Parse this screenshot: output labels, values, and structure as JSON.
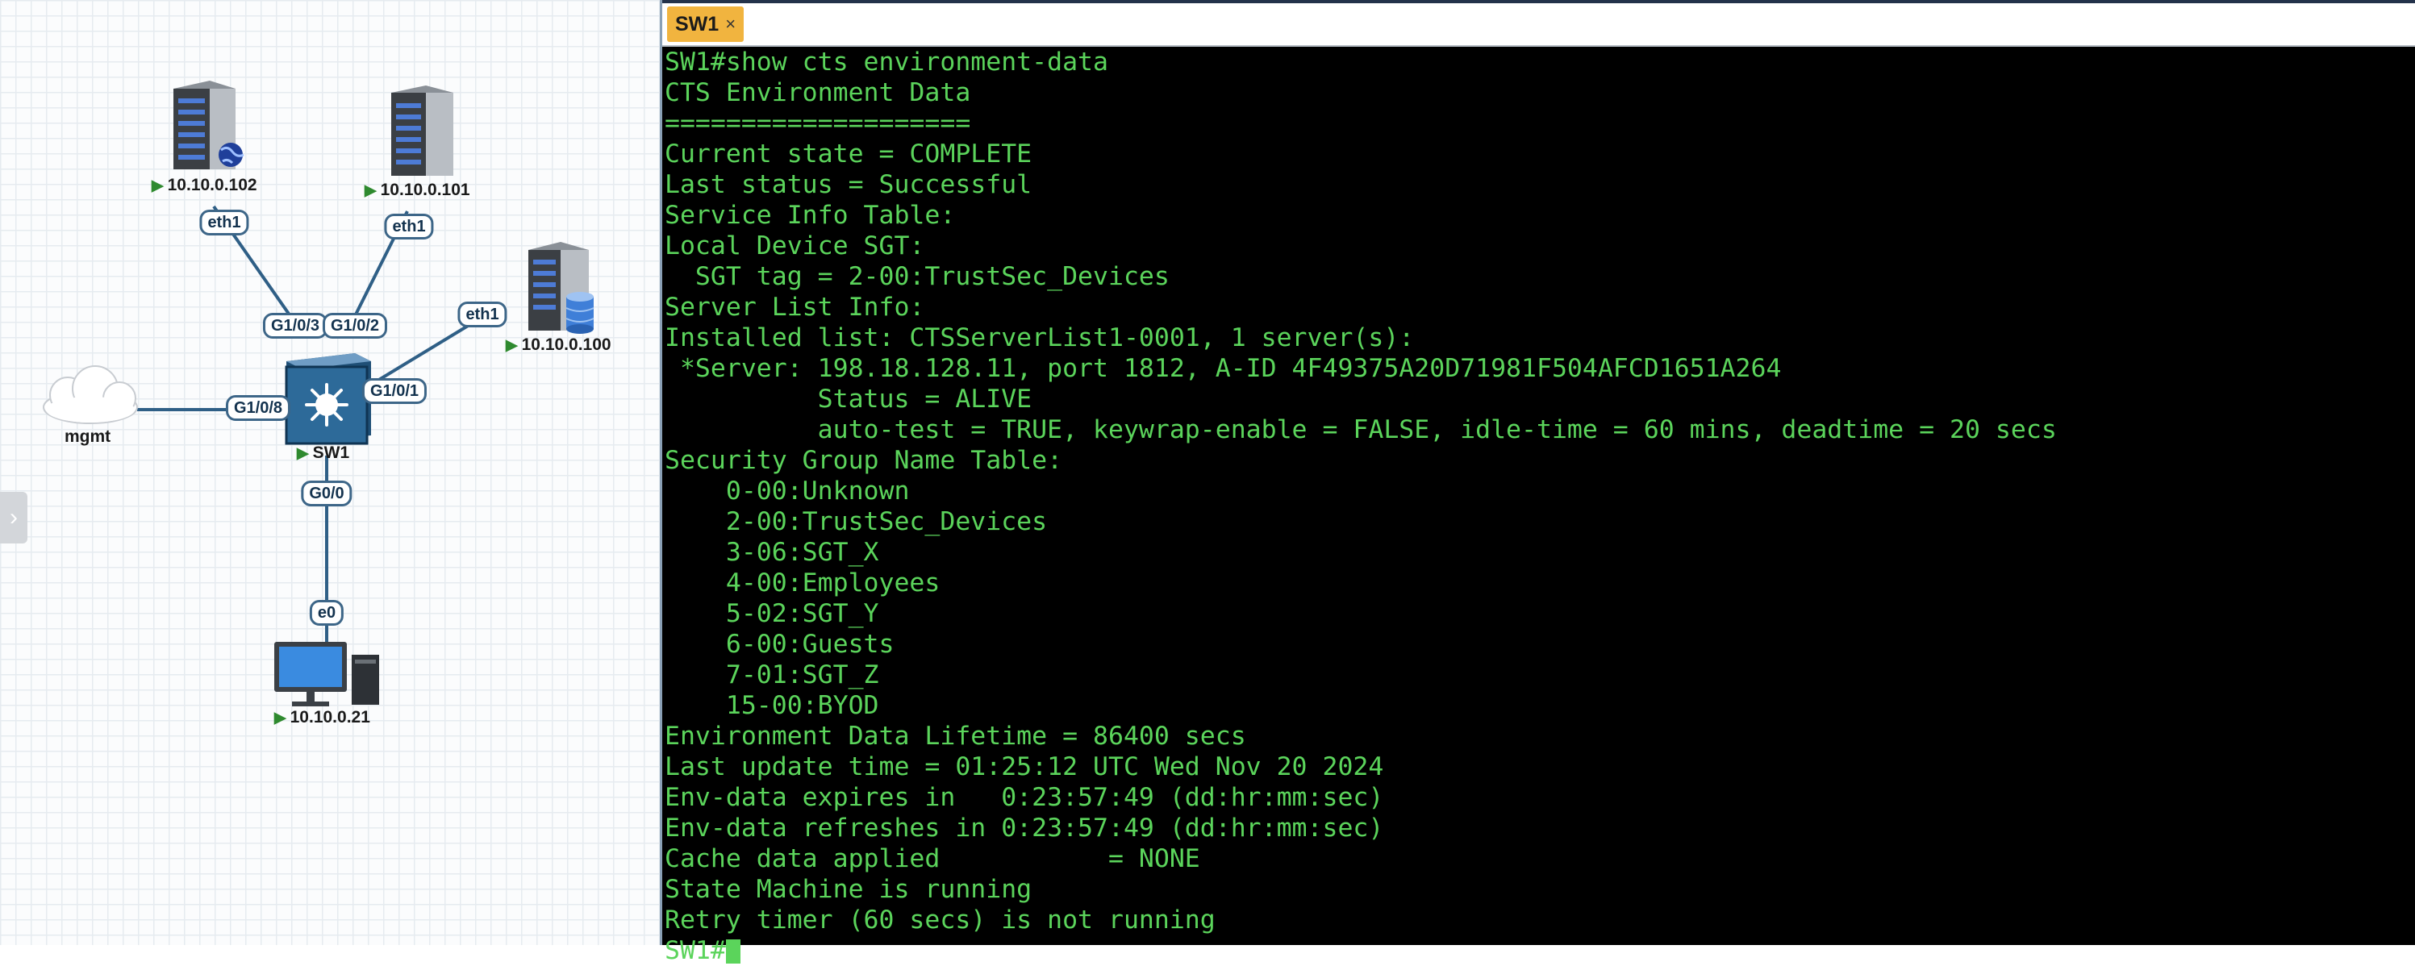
{
  "terminal": {
    "tab": {
      "title": "SW1",
      "close": "×"
    },
    "lines": [
      "SW1#show cts environment-data",
      "CTS Environment Data",
      "====================",
      "Current state = COMPLETE",
      "Last status = Successful",
      "Service Info Table:",
      "Local Device SGT:",
      "  SGT tag = 2-00:TrustSec_Devices",
      "Server List Info:",
      "Installed list: CTSServerList1-0001, 1 server(s):",
      " *Server: 198.18.128.11, port 1812, A-ID 4F49375A20D71981F504AFCD1651A264",
      "          Status = ALIVE",
      "          auto-test = TRUE, keywrap-enable = FALSE, idle-time = 60 mins, deadtime = 20 secs",
      "Security Group Name Table:",
      "    0-00:Unknown",
      "    2-00:TrustSec_Devices",
      "    3-06:SGT_X",
      "    4-00:Employees",
      "    5-02:SGT_Y",
      "    6-00:Guests",
      "    7-01:SGT_Z",
      "    15-00:BYOD",
      "Environment Data Lifetime = 86400 secs",
      "Last update time = 01:25:12 UTC Wed Nov 20 2024",
      "Env-data expires in   0:23:57:49 (dd:hr:mm:sec)",
      "Env-data refreshes in 0:23:57:49 (dd:hr:mm:sec)",
      "Cache data applied           = NONE",
      "State Machine is running",
      "Retry timer (60 secs) is not running"
    ],
    "prompt": "SW1#"
  },
  "topology": {
    "nodes": {
      "server_102": "10.10.0.102",
      "server_101": "10.10.0.101",
      "server_100": "10.10.0.100",
      "mgmt": "mgmt",
      "sw1": "SW1",
      "pc": "10.10.0.21"
    },
    "ports": {
      "s102_eth1": "eth1",
      "s101_eth1": "eth1",
      "s100_eth1": "eth1",
      "sw_g103": "G1/0/3",
      "sw_g102": "G1/0/2",
      "sw_g101": "G1/0/1",
      "sw_g108": "G1/0/8",
      "sw_g00": "G0/0",
      "pc_e0": "e0"
    },
    "run_icon": "play-icon",
    "colors": {
      "link": "#2f5f86",
      "port_border": "#3d6688",
      "terminal_text": "#5bd45b",
      "tab": "#f1b43f",
      "running": "#2f8a2f"
    }
  }
}
